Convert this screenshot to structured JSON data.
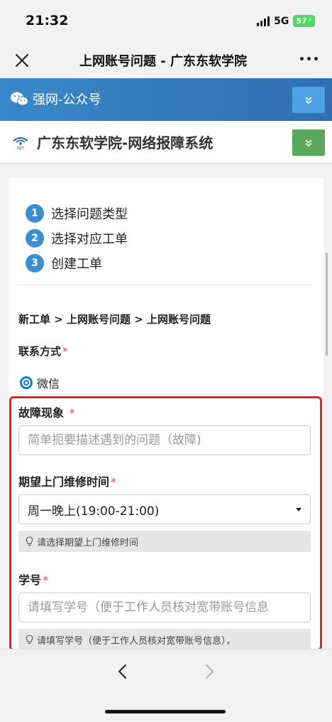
{
  "status_bar": {
    "time": "21:32",
    "network": "5G",
    "battery": "57"
  },
  "nav": {
    "title": "上网账号问题 - 广东东软学院"
  },
  "banners": {
    "wechat": "强网-公众号",
    "system": "广东东软学院-网络报障系统"
  },
  "steps": [
    {
      "num": "1",
      "label": "选择问题类型"
    },
    {
      "num": "2",
      "label": "选择对应工单"
    },
    {
      "num": "3",
      "label": "创建工单"
    }
  ],
  "breadcrumb": "新工单 > 上网账号问题 > 上网账号问题",
  "contact": {
    "label": "联系方式",
    "required": "*",
    "option": "微信"
  },
  "fault": {
    "label": "故障现象",
    "required": "*",
    "placeholder": "简单扼要描述遇到的问题（故障)"
  },
  "visit_time": {
    "label": "期望上门维修时间",
    "required": "*",
    "value": "周一晚上(19:00-21:00)",
    "help": "请选择期望上门维修时间"
  },
  "student_id": {
    "label": "学号",
    "required": "*",
    "placeholder": "请填写学号（便于工作人员核对宽带账号信息",
    "help": "请填写学号（便于工作人员核对宽带账号信息），"
  },
  "colors": {
    "accent": "#3a8fd0",
    "highlight": "#e8202a",
    "green": "#5aa85a"
  }
}
